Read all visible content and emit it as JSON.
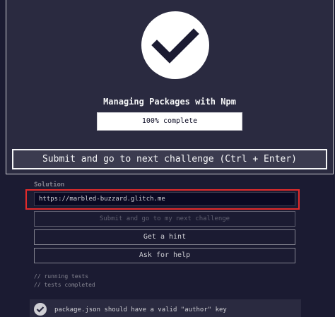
{
  "modal": {
    "title": "Managing Packages with Npm",
    "progress_text": "100% complete",
    "progress_value": 1.0,
    "submit_label": "Submit and go to next challenge (Ctrl + Enter)"
  },
  "form": {
    "solution_label": "Solution",
    "solution_value": "https://marbled-buzzard.glitch.me"
  },
  "buttons": {
    "submit_next_label": "Submit and go to my next challenge",
    "hint_label": "Get a hint",
    "help_label": "Ask for help"
  },
  "console": {
    "lines": [
      "// running tests",
      "// tests completed"
    ]
  },
  "tests": [
    {
      "text": "package.json should have a valid \"author\" key",
      "passed": true
    }
  ],
  "icons": {
    "completion": "check-circle-icon",
    "test_status": "check-circle-icon"
  },
  "colors": {
    "background": "#1b1b32",
    "modal_bg": "#2a2a40",
    "highlight": "#e22b2b",
    "text_primary": "#f5f6f7",
    "check_mark": "#1b1b32"
  }
}
